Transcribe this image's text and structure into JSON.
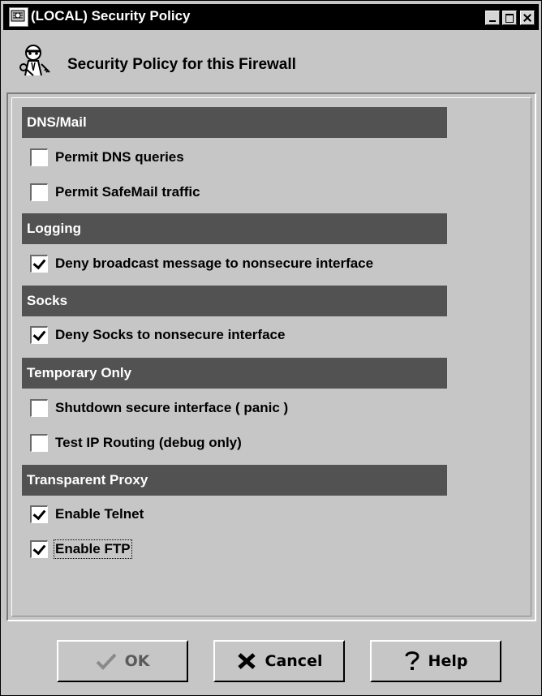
{
  "window": {
    "title": "(LOCAL) Security Policy",
    "heading": "Security Policy for this Firewall"
  },
  "sections": [
    {
      "header": "DNS/Mail",
      "options": [
        {
          "label": "Permit DNS queries",
          "checked": false
        },
        {
          "label": "Permit SafeMail traffic",
          "checked": false
        }
      ]
    },
    {
      "header": "Logging",
      "options": [
        {
          "label": "Deny broadcast message to nonsecure interface",
          "checked": true
        }
      ]
    },
    {
      "header": "Socks",
      "options": [
        {
          "label": "Deny Socks to nonsecure interface",
          "checked": true
        }
      ]
    },
    {
      "header": "Temporary Only",
      "options": [
        {
          "label": "Shutdown secure interface ( panic )",
          "checked": false
        },
        {
          "label": "Test IP Routing (debug only)",
          "checked": false
        }
      ]
    },
    {
      "header": "Transparent Proxy",
      "options": [
        {
          "label": "Enable Telnet",
          "checked": true
        },
        {
          "label": "Enable FTP",
          "checked": true
        }
      ]
    }
  ],
  "buttons": {
    "ok": "OK",
    "cancel": "Cancel",
    "help": "Help"
  },
  "icons": {
    "app": "security-policy-app-icon",
    "heading": "agent-key-icon",
    "ok": "checkmark-icon",
    "cancel": "x-icon",
    "help": "question-icon"
  }
}
